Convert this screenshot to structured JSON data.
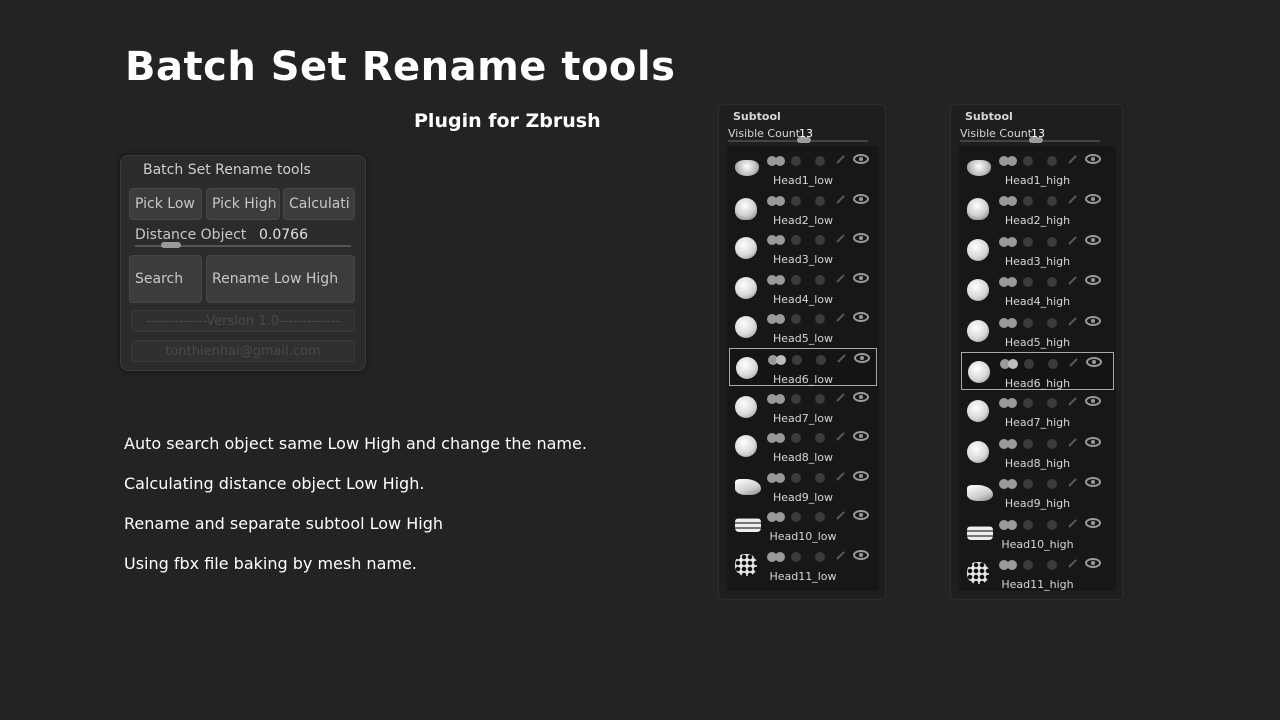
{
  "title": "Batch Set Rename tools",
  "subtitle": "Plugin for Zbrush",
  "plugin": {
    "header": "Batch Set Rename tools",
    "pick_low": "Pick Low",
    "pick_high": "Pick High",
    "calculate": "Calculati",
    "distance_label": "Distance Object",
    "distance_value": "0.0766",
    "search": "Search",
    "rename": "Rename Low High",
    "version": "-------------Version 1.0-------------",
    "email": "tonthienhai@gmail.com"
  },
  "features": [
    "Auto search object same Low High and change the name.",
    "Calculating distance object Low High.",
    "Rename and separate subtool Low High",
    "Using fbx file baking by mesh name."
  ],
  "subtool_low": {
    "header": "Subtool",
    "visible_count_label": "Visible Count",
    "visible_count": "13",
    "selected": "Head6_low",
    "items": [
      "Head1_low",
      "Head2_low",
      "Head3_low",
      "Head4_low",
      "Head5_low",
      "Head6_low",
      "Head7_low",
      "Head8_low",
      "Head9_low",
      "Head10_low",
      "Head11_low"
    ]
  },
  "subtool_high": {
    "header": "Subtool",
    "visible_count_label": "Visible Count",
    "visible_count": "13",
    "selected": "Head6_high",
    "items": [
      "Head1_high",
      "Head2_high",
      "Head3_high",
      "Head4_high",
      "Head5_high",
      "Head6_high",
      "Head7_high",
      "Head8_high",
      "Head9_high",
      "Head10_high",
      "Head11_high"
    ]
  },
  "icons": [
    "eye-icon",
    "toggle-icon",
    "brush-icon",
    "subtool-thumbnail-icon"
  ]
}
